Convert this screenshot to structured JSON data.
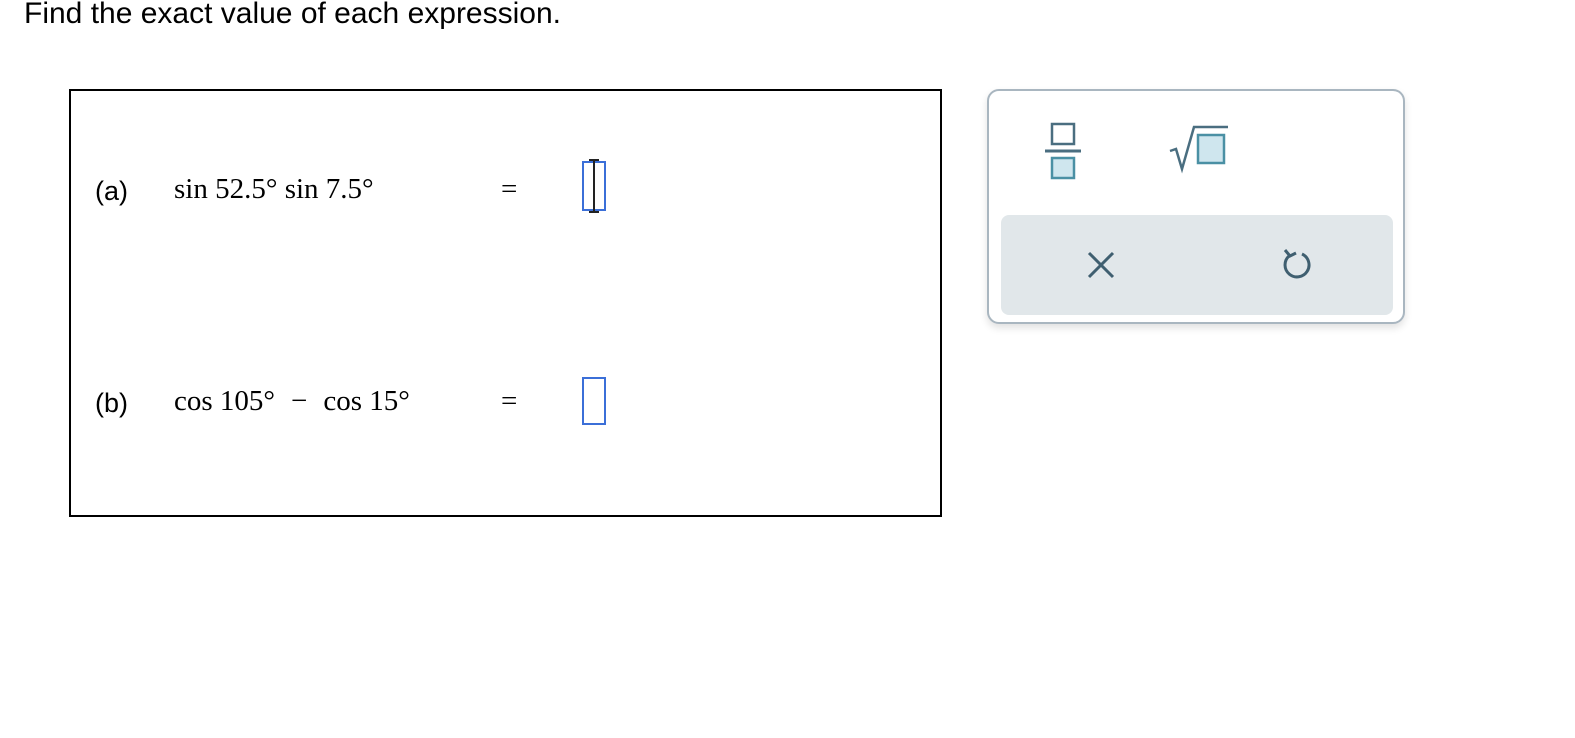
{
  "instruction": "Find the exact value of each expression.",
  "parts": [
    {
      "label": "(a)",
      "expression": "sin 52.5° sin 7.5°",
      "equals": "=",
      "answer": ""
    },
    {
      "label": "(b)",
      "expression_left": "cos 105°",
      "operator": "−",
      "expression_right": "cos 15°",
      "equals": "=",
      "answer": ""
    }
  ],
  "toolbox": {
    "tools": [
      "fraction-icon",
      "square-root-icon"
    ],
    "actions": [
      "clear-icon",
      "undo-icon"
    ],
    "accent_color": "#3b6fd8",
    "tool_fill_color": "#cfe6ee",
    "tool_stroke_color": "#4a90a4"
  }
}
